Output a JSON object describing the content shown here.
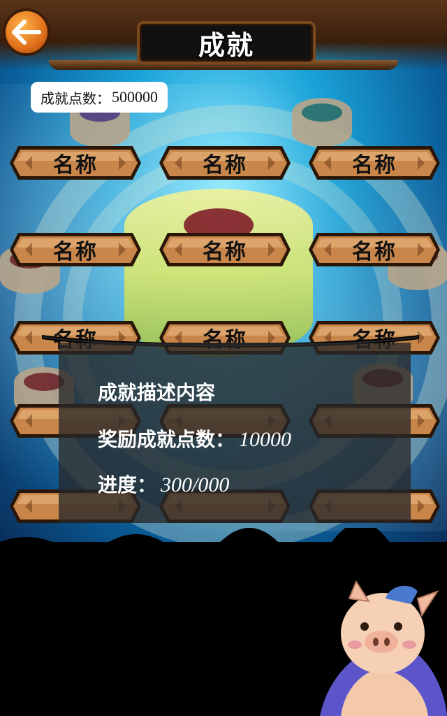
{
  "header": {
    "title": "成就"
  },
  "points": {
    "label": "成就点数：",
    "value": "500000"
  },
  "achievements": [
    {
      "label": "名称"
    },
    {
      "label": "名称"
    },
    {
      "label": "名称"
    },
    {
      "label": "名称"
    },
    {
      "label": "名称"
    },
    {
      "label": "名称"
    },
    {
      "label": "名称"
    },
    {
      "label": "名称"
    },
    {
      "label": "名称"
    },
    {
      "label": ""
    },
    {
      "label": ""
    },
    {
      "label": ""
    },
    {
      "label": ""
    },
    {
      "label": ""
    },
    {
      "label": ""
    }
  ],
  "detail": {
    "description": "成就描述内容",
    "reward_label": "奖励成就点数：",
    "reward_value": "10000",
    "progress_label": "进度：",
    "progress_value": "300/000"
  },
  "colors": {
    "button_fill": "#c9864a",
    "button_border": "#2a1606",
    "back_button": "#e0701a"
  }
}
